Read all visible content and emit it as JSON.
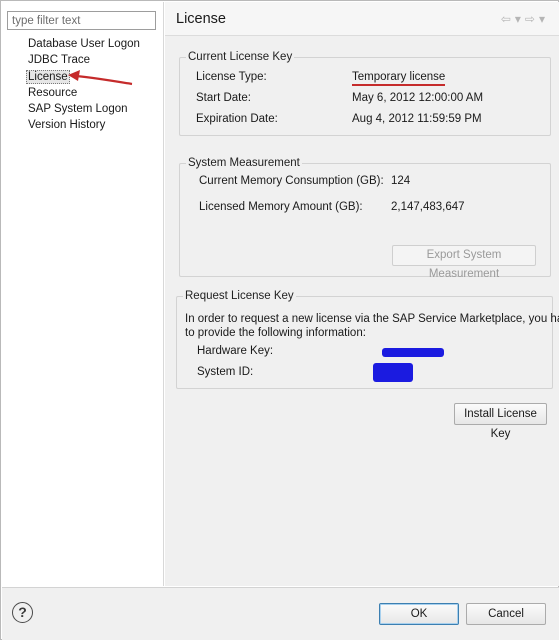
{
  "filter": {
    "placeholder": "type filter text"
  },
  "tree": {
    "items": [
      {
        "label": "Database User Logon"
      },
      {
        "label": "JDBC Trace"
      },
      {
        "label": "License"
      },
      {
        "label": "Resource"
      },
      {
        "label": "SAP System Logon"
      },
      {
        "label": "Version History"
      }
    ],
    "selected": "License"
  },
  "page": {
    "title": "License"
  },
  "license_key": {
    "group_label": "Current License Key",
    "type_label": "License Type:",
    "type_value": "Temporary license",
    "start_label": "Start Date:",
    "start_value": "May 6, 2012 12:00:00 AM",
    "expiration_label": "Expiration Date:",
    "expiration_value": "Aug 4, 2012 11:59:59 PM"
  },
  "measurement": {
    "group_label": "System Measurement",
    "current_label": "Current Memory Consumption (GB):",
    "current_value": "124",
    "licensed_label": "Licensed Memory Amount (GB):",
    "licensed_value": "2,147,483,647",
    "export_button": "Export System Measurement"
  },
  "request": {
    "group_label": "Request License Key",
    "description": "In order to request a new license via the SAP Service Marketplace, you have to provide the following information:",
    "description_line1": "In order to request a new license via the SAP Service Marketplace, you have",
    "description_line2": "to provide the following information:",
    "hardware_label": "Hardware Key:",
    "system_label": "System ID:"
  },
  "install_button": "Install License Key",
  "ok_button": "OK",
  "cancel_button": "Cancel",
  "colors": {
    "annotation_red": "#c52b2b",
    "redaction_blue": "#1b1be0"
  },
  "icons": {
    "help": "help-icon",
    "back": "back-arrow-icon",
    "forward": "forward-arrow-icon",
    "annotation": "red-arrow-annotation"
  }
}
